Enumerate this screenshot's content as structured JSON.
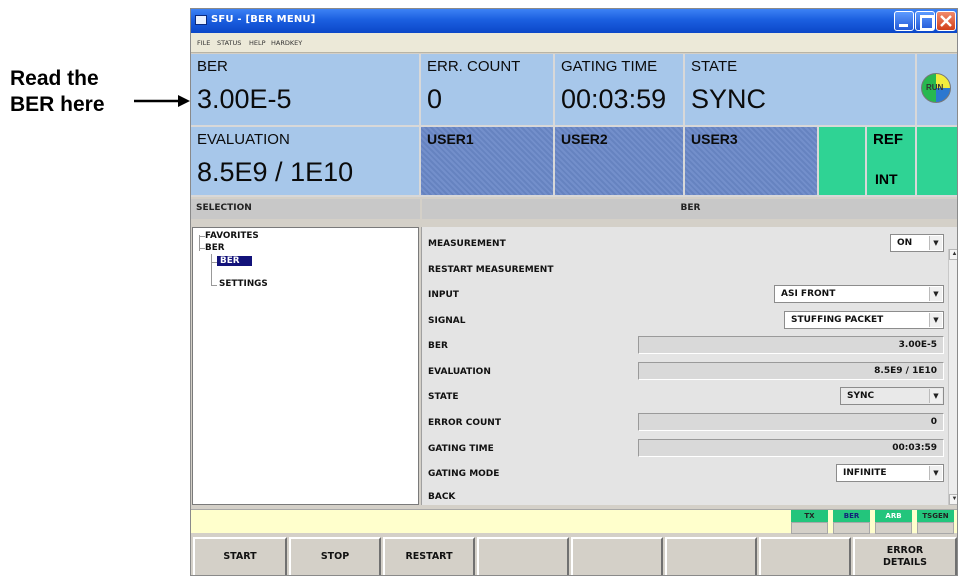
{
  "annotation": {
    "line1": "Read the",
    "line2": "BER here"
  },
  "window": {
    "title": "SFU - [BER MENU]"
  },
  "menu": [
    "FILE",
    "STATUS",
    "HELP",
    "HARDKEY"
  ],
  "tiles": {
    "ber": {
      "label": "BER",
      "value": "3.00E-5"
    },
    "err_count": {
      "label": "ERR. COUNT",
      "value": "0"
    },
    "gating_time": {
      "label": "GATING TIME",
      "value": "00:03:59"
    },
    "state": {
      "label": "STATE",
      "value": "SYNC"
    },
    "run": "RUN",
    "evaluation": {
      "label": "EVALUATION",
      "value": "8.5E9 / 1E10"
    },
    "user1": "USER1",
    "user2": "USER2",
    "user3": "USER3",
    "ref_line1": "REF",
    "ref_line2": "INT"
  },
  "selection": {
    "title": "SELECTION",
    "favorites": "FAVORITES",
    "ber_group": "BER",
    "ber_item": "BER",
    "settings_item": "SETTINGS"
  },
  "ber_panel": {
    "title": "BER",
    "measurement": {
      "label": "MEASUREMENT",
      "value": "ON"
    },
    "restart": {
      "label": "RESTART MEASUREMENT"
    },
    "input": {
      "label": "INPUT",
      "value": "ASI FRONT"
    },
    "signal": {
      "label": "SIGNAL",
      "value": "STUFFING PACKET"
    },
    "ber": {
      "label": "BER",
      "value": "3.00E-5"
    },
    "evaluation": {
      "label": "EVALUATION",
      "value": "8.5E9 / 1E10"
    },
    "state": {
      "label": "STATE",
      "value": "SYNC"
    },
    "error_count": {
      "label": "ERROR COUNT",
      "value": "0"
    },
    "gating_time": {
      "label": "GATING TIME",
      "value": "00:03:59"
    },
    "gating_mode": {
      "label": "GATING MODE",
      "value": "INFINITE"
    },
    "back": {
      "label": "BACK"
    }
  },
  "mode_tabs": [
    "TX",
    "BER",
    "ARB",
    "TSGEN"
  ],
  "softkeys": [
    "START",
    "STOP",
    "RESTART",
    "",
    "",
    "",
    "",
    "ERROR\nDETAILS"
  ],
  "colors": {
    "tile_blue": "#a7c7ea",
    "user_blue": "#6a88c8",
    "green": "#2fd394",
    "selected": "#12127a"
  }
}
